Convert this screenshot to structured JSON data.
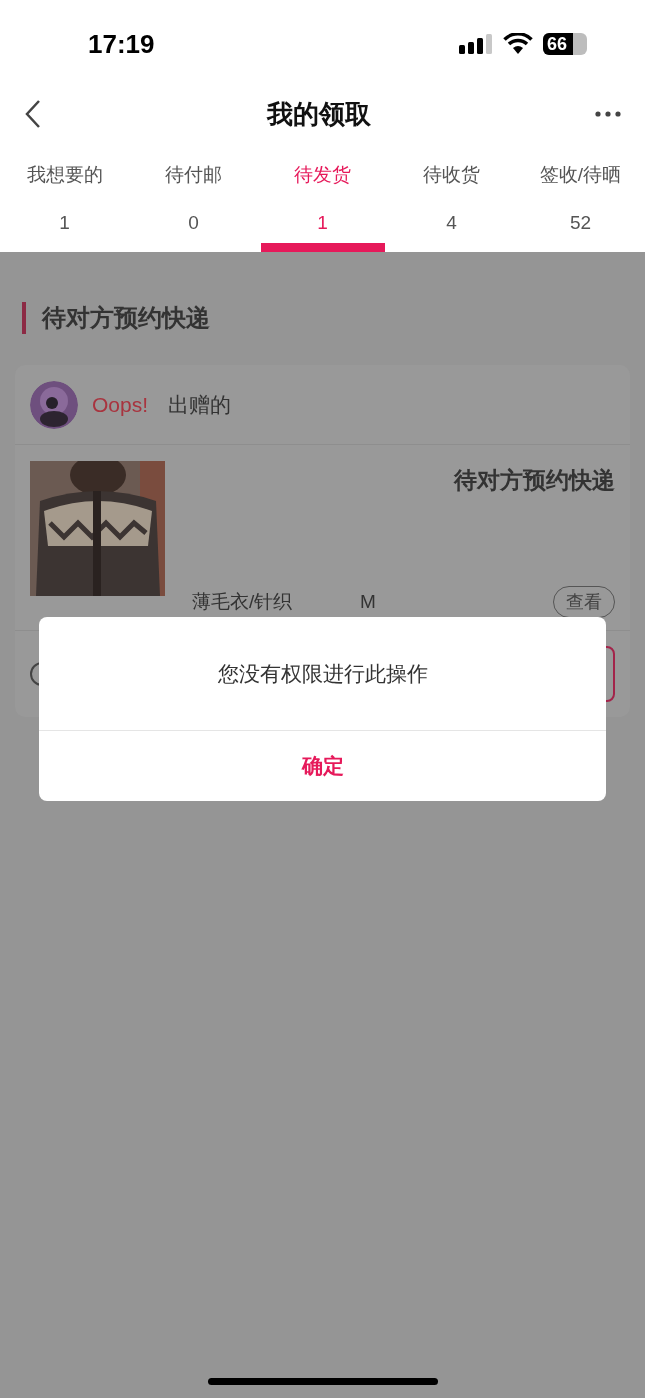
{
  "status_bar": {
    "time": "17:19",
    "battery": "66"
  },
  "nav": {
    "title": "我的领取"
  },
  "tabs": [
    {
      "label": "我想要的",
      "count": "1",
      "selected": false
    },
    {
      "label": "待付邮",
      "count": "0",
      "selected": false
    },
    {
      "label": "待发货",
      "count": "1",
      "selected": true
    },
    {
      "label": "待收货",
      "count": "4",
      "selected": false
    },
    {
      "label": "签收/待晒",
      "count": "52",
      "selected": false
    }
  ],
  "section": {
    "title": "待对方预约快递"
  },
  "order": {
    "user": "Oops!",
    "relation": "出赠的",
    "status": "待对方预约快递",
    "category": "薄毛衣/针织",
    "size": "M",
    "view_button": "查看"
  },
  "dialog": {
    "message": "您没有权限进行此操作",
    "confirm": "确定"
  }
}
